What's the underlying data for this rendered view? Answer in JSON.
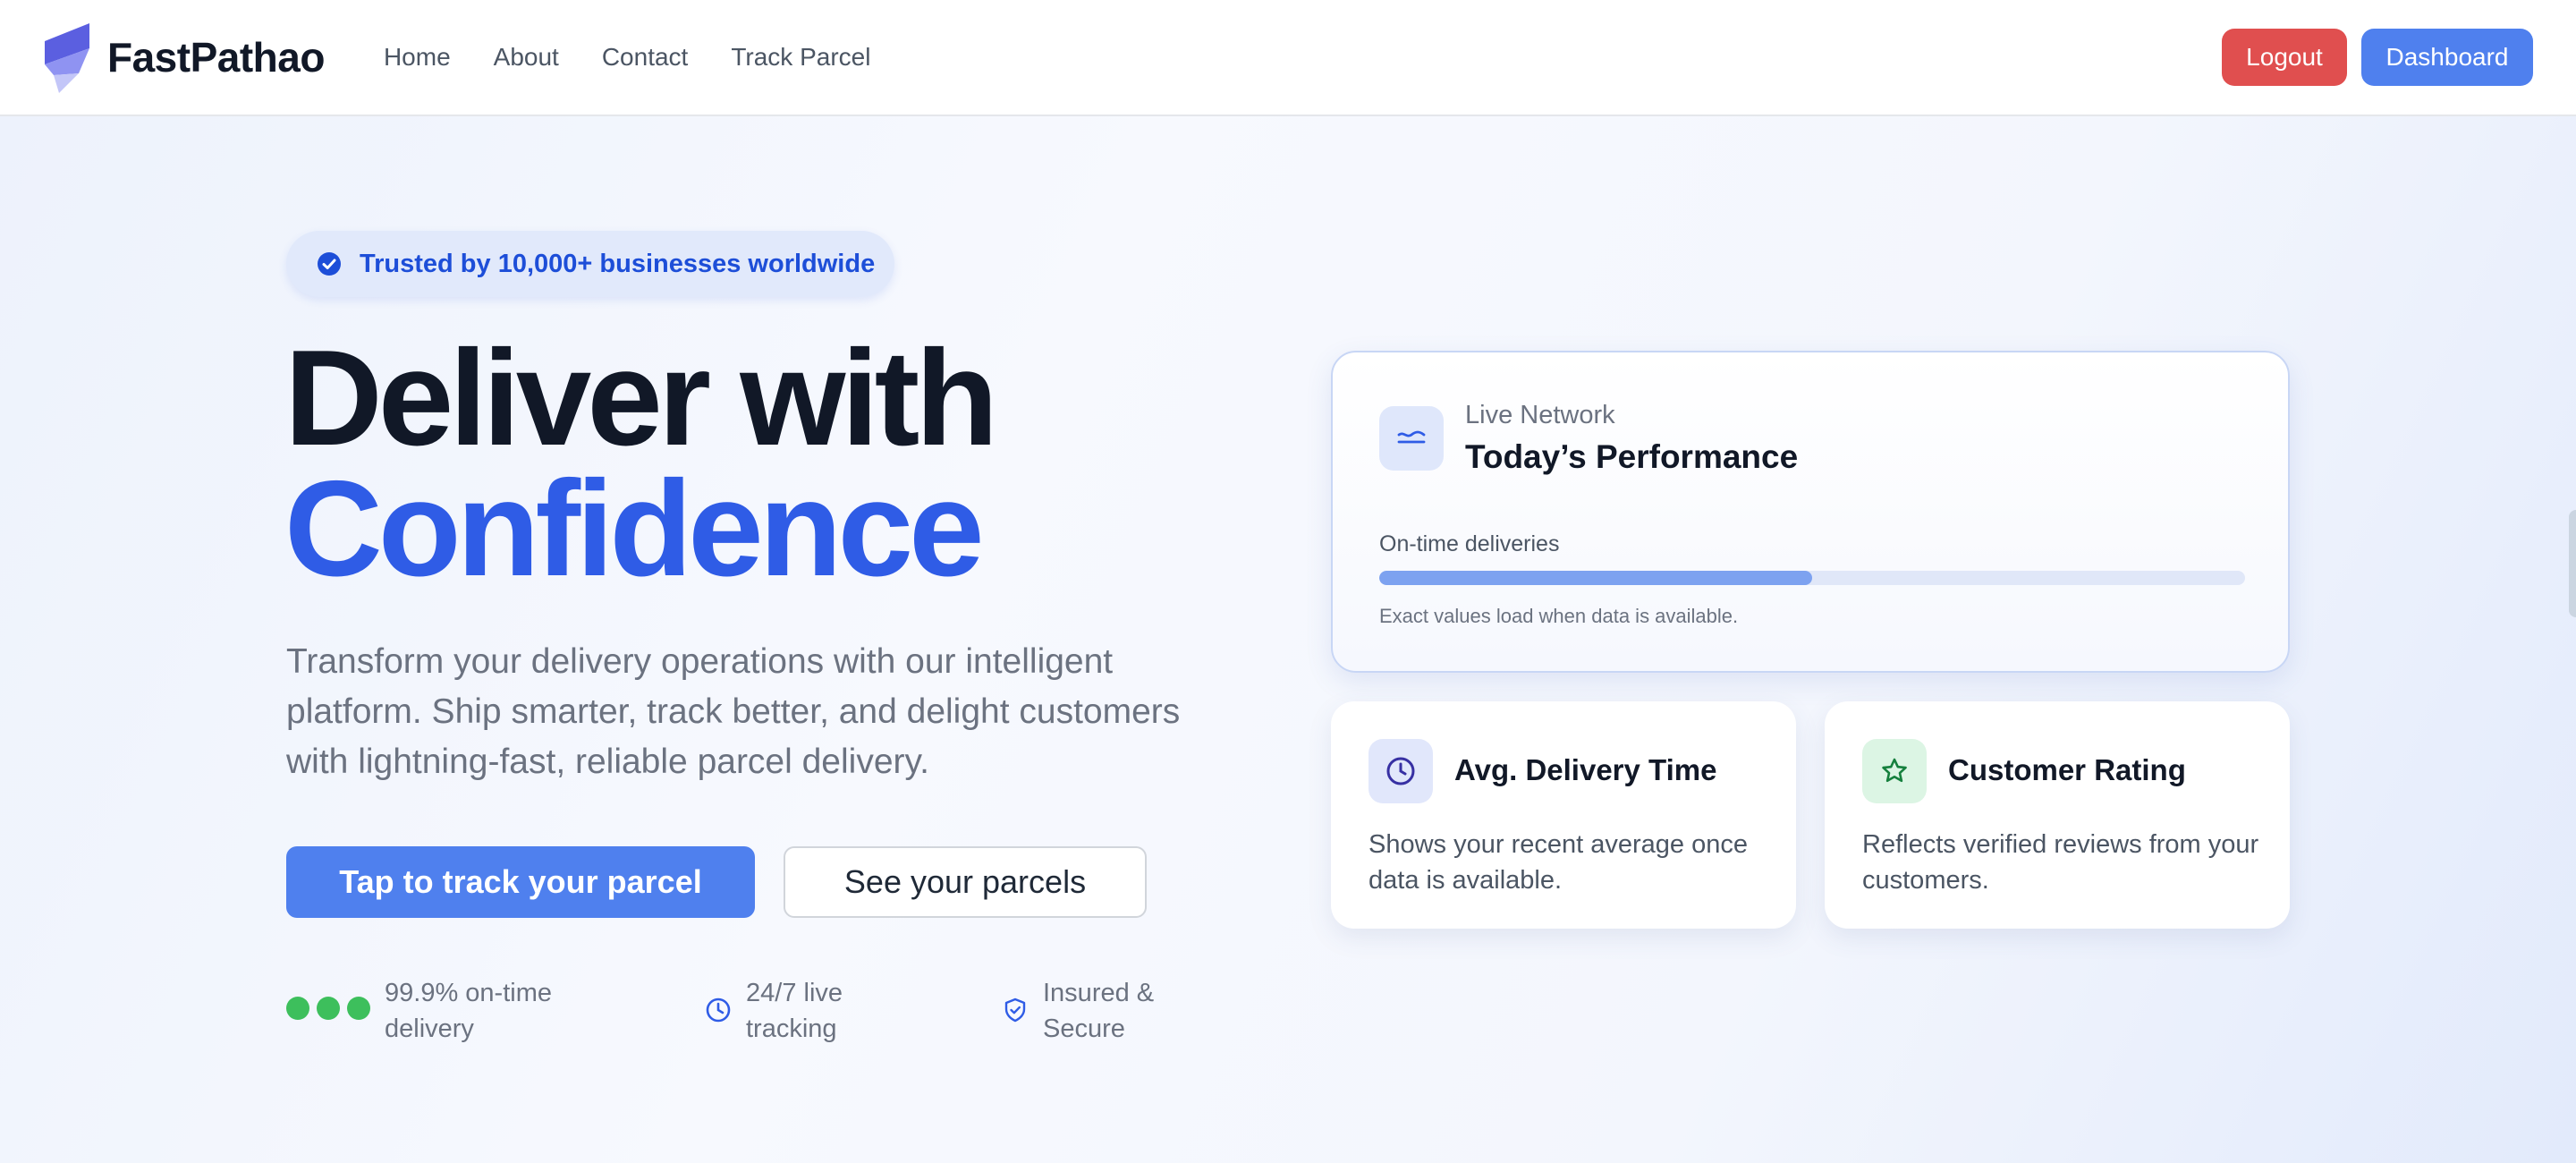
{
  "brand": {
    "name": "FastPathao",
    "logo_icon": "fastpathao-logo-icon"
  },
  "nav": {
    "links": [
      "Home",
      "About",
      "Contact",
      "Track Parcel"
    ],
    "logout_label": "Logout",
    "dashboard_label": "Dashboard"
  },
  "hero": {
    "badge_text": "Trusted by 10,000+ businesses worldwide",
    "headline_line1": "Deliver with",
    "headline_line2": "Confidence",
    "subtext": "Transform your delivery operations with our intelligent platform. Ship smarter, track better, and delight customers with lightning-fast, reliable parcel delivery.",
    "cta_primary": "Tap to track your parcel",
    "cta_secondary": "See your parcels",
    "features": [
      {
        "icon": "status-dots-icon",
        "text": "99.9% on-time delivery"
      },
      {
        "icon": "clock-icon",
        "text": "24/7 live tracking"
      },
      {
        "icon": "shield-check-icon",
        "text": "Insured & Secure"
      }
    ]
  },
  "performance": {
    "eyebrow": "Live Network",
    "title": "Today’s Performance",
    "metric_label": "On-time deliveries",
    "progress_fraction": 0.5,
    "note": "Exact values load when data is available."
  },
  "cards": [
    {
      "icon": "clock-icon",
      "title": "Avg. Delivery Time",
      "description": "Shows your recent average once data is available."
    },
    {
      "icon": "star-icon",
      "title": "Customer Rating",
      "description": "Reflects verified reviews from your customers."
    }
  ],
  "colors": {
    "accent": "#2f5ce6",
    "primary_button": "#4f80ee",
    "logout_button": "#e04f4f",
    "success": "#3dbf5c"
  }
}
